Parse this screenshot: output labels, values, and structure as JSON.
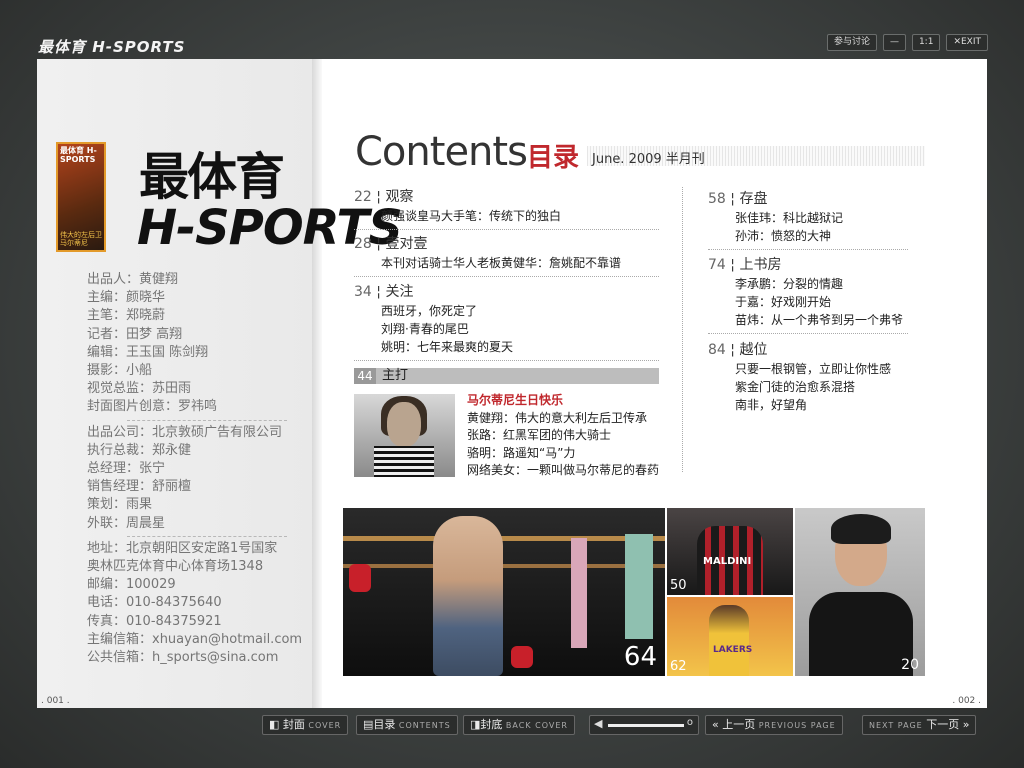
{
  "brand": "最体育 H-SPORTS",
  "top_buttons": {
    "discuss": "参与讨论",
    "minimize": "—",
    "actual": "1:1",
    "exit": "EXIT"
  },
  "cover": {
    "top": "最体育 H-SPORTS",
    "bottom": "伟大的左后卫 马尔蒂尼"
  },
  "logo": {
    "cn": "最体育",
    "en": "H-SPORTS"
  },
  "credits_group1": [
    "出品人：黄健翔",
    "主编：颜晓华",
    "主笔：郑晓蔚",
    "记者：田梦 高翔",
    "编辑：王玉国 陈剑翔",
    "摄影：小船",
    "视觉总监：苏田雨",
    "封面图片创意：罗祎鸣"
  ],
  "credits_group2": [
    "出品公司：北京敦硕广告有限公司",
    "执行总裁：郑永健",
    "总经理：张宁",
    "销售经理：舒丽檀",
    "策划：雨果",
    "外联：周晨星"
  ],
  "credits_group3": [
    "地址：北京朝阳区安定路1号国家",
    "奥林匹克体育中心体育场1348",
    "邮编：100029",
    "电话：010-84375640",
    "传真：010-84375921",
    "主编信箱：xhuayan@hotmail.com",
    "公共信箱：h_sports@sina.com"
  ],
  "page_left": ". 001 .",
  "page_right": ". 002 .",
  "contents": {
    "title": "Contents",
    "cn": "目录",
    "date": "June. 2009  半月刊"
  },
  "sections_left": [
    {
      "num": "22",
      "title": "观察",
      "items": [
        "颜强谈皇马大手笔：传统下的独白"
      ]
    },
    {
      "num": "28",
      "title": "壹对壹",
      "items": [
        "本刊对话骑士华人老板黄健华：詹姚配不靠谱"
      ]
    },
    {
      "num": "34",
      "title": "关注",
      "items": [
        "西班牙，你死定了",
        "刘翔·青春的尾巴",
        "姚明：七年来最爽的夏天"
      ]
    }
  ],
  "headline": {
    "num": "44",
    "title": "主打"
  },
  "feature": {
    "title": "马尔蒂尼生日快乐",
    "items": [
      "黄健翔：伟大的意大利左后卫传承",
      "张路：红黑军团的伟大骑士",
      "骆明：路遥知“马”力",
      "网络美女：一颗叫做马尔蒂尼的春药"
    ]
  },
  "sections_right": [
    {
      "num": "58",
      "title": "存盘",
      "items": [
        "张佳玮：科比越狱记",
        "孙沛：愤怒的大神"
      ]
    },
    {
      "num": "74",
      "title": "上书房",
      "items": [
        "李承鹏：分裂的情趣",
        "于嘉：好戏刚开始",
        "苗炜：从一个弗爷到另一个弗爷"
      ]
    },
    {
      "num": "84",
      "title": "越位",
      "items": [
        "只要一根钢管，立即让你性感",
        "紫金门徒的治愈系混搭",
        "南非，好望角"
      ]
    }
  ],
  "photos": {
    "p1": "64",
    "p2": "50",
    "p3": "62",
    "p4": "20",
    "jersey": "MALDINI",
    "lakers": "LAKERS"
  },
  "bottom": {
    "cover": "封面",
    "cover_en": "COVER",
    "contents": "目录",
    "contents_en": "CONTENTS",
    "back": "封底",
    "back_en": "BACK COVER",
    "vol_end": "o",
    "prev": "上一页",
    "prev_en": "PREVIOUS PAGE",
    "next_en": "NEXT PAGE",
    "next": "下一页"
  }
}
